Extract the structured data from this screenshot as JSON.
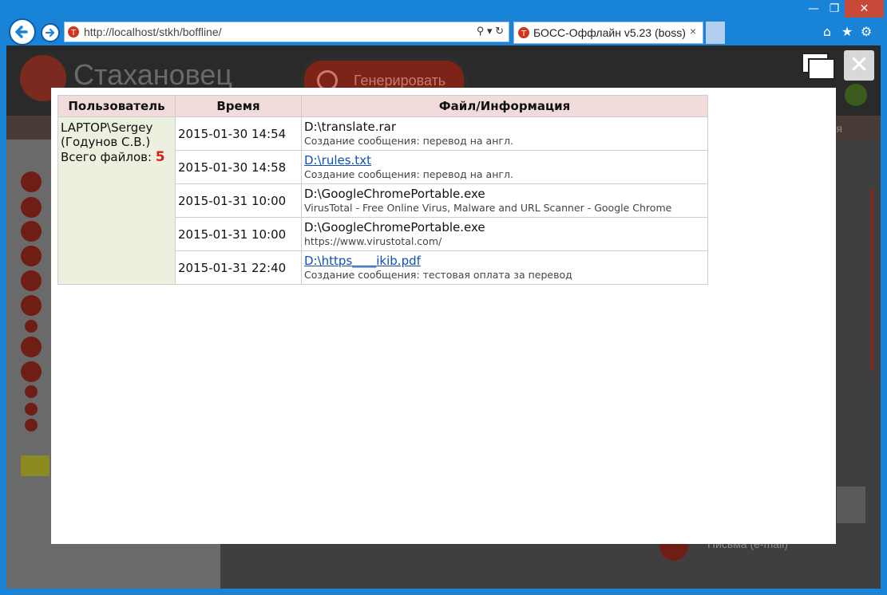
{
  "browser": {
    "url": "http://localhost/stkh/boffline/",
    "tab_title": "БОСС-Оффлайн v5.23 (boss)",
    "addr_tools": "⚲ ▾ ↻",
    "tab_close": "×",
    "window_controls": {
      "min": "—",
      "max": "❐",
      "close": "✕"
    },
    "icons": {
      "home": "⌂",
      "favorites": "★",
      "settings": "⚙"
    }
  },
  "app": {
    "logo_text": "Стахановец",
    "generate_label": "Генерировать",
    "nav_time_label": "емя",
    "right_label": "Письма (e-mail)",
    "dialog_close": "✕"
  },
  "modal": {
    "headers": {
      "user": "Пользователь",
      "time": "Время",
      "file": "Файл/Информация"
    },
    "user": {
      "login": "LAPTOP\\Sergey",
      "name": "(Годунов С.В.)",
      "total_label": "Всего файлов: ",
      "total_count": "5"
    },
    "rows": [
      {
        "time": "2015-01-30 14:54",
        "file": "D:\\translate.rar",
        "info": "Создание сообщения: перевод на англ."
      },
      {
        "time": "2015-01-30 14:58",
        "file": "D:\\rules.txt",
        "info": "Создание сообщения: перевод на англ."
      },
      {
        "time": "2015-01-31 10:00",
        "file": "D:\\GoogleChromePortable.exe",
        "info": "VirusTotal - Free Online Virus, Malware and URL Scanner - Google Chrome"
      },
      {
        "time": "2015-01-31 10:00",
        "file": "D:\\GoogleChromePortable.exe",
        "info": "https://www.virustotal.com/"
      },
      {
        "time": "2015-01-31 22:40",
        "file": "D:\\https____ikib.pdf",
        "info": "Создание сообщения: тестовая оплата за перевод"
      }
    ]
  }
}
